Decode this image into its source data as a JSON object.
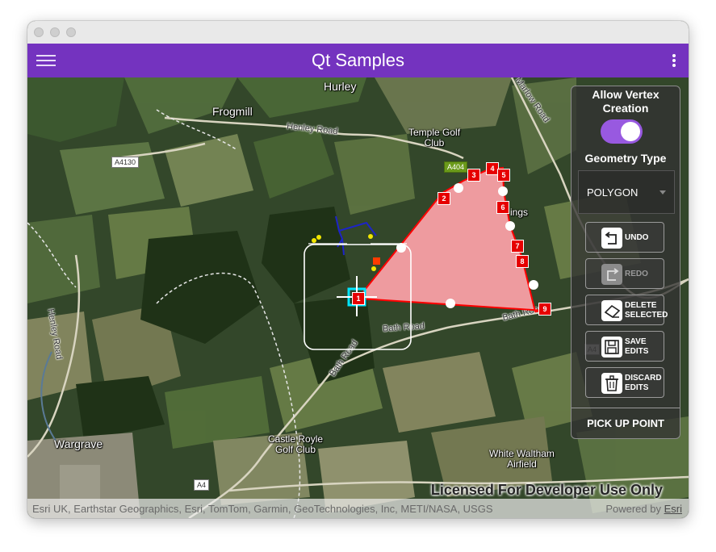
{
  "window": {
    "app_title": "Qt Samples"
  },
  "icons": {
    "menu": "hamburger-menu-icon",
    "more": "more-vertical-icon",
    "undo": "undo-icon",
    "redo": "redo-icon",
    "delete": "eraser-icon",
    "save": "floppy-disk-icon",
    "discard": "trash-icon"
  },
  "colors": {
    "app_bar": "#7433bf",
    "toggle_on": "#9859e0",
    "polygon_fill": "#f9a0a5",
    "polygon_outline": "#ff0000",
    "vertex_marker": "#e60000",
    "selected_vertex_halo": "#00e5ff",
    "sketch_line": "#1d24c8"
  },
  "map_labels": {
    "hurley": "Hurley",
    "frogmill": "Frogmill",
    "henley_road_top": "Henley Road",
    "temple_golf_club": "Temple Golf\nClub",
    "marlow_road": "Marlow Road",
    "a4130": "A4130",
    "a404": "A404",
    "ings": "ings",
    "bath_road_1": "Bath Road",
    "bath_road_2": "Bath Road",
    "bath_road_3": "Bath Road",
    "henley_road_left": "Henley Road",
    "wargrave": "Wargrave",
    "castle_royle": "Castle Royle\nGolf Club",
    "white_waltham": "White Waltham\nAirfield",
    "a4_shield": "A4",
    "a4_right_shield": "A4"
  },
  "vertices": [
    "1",
    "2",
    "3",
    "4",
    "5",
    "6",
    "7",
    "8",
    "9"
  ],
  "panel": {
    "allow_vertex_label": "Allow Vertex Creation",
    "allow_vertex_on": true,
    "geometry_type_label": "Geometry Type",
    "geometry_type_value": "POLYGON",
    "buttons": {
      "undo": "UNDO",
      "redo": "REDO",
      "delete": "DELETE SELECTED",
      "save": "SAVE EDITS",
      "discard": "DISCARD EDITS"
    },
    "pick_up_point": "PICK UP POINT"
  },
  "license_text": "Licensed For Developer Use Only",
  "attribution": "Esri UK, Earthstar Geographics, Esri, TomTom, Garmin, GeoTechnologies, Inc, METI/NASA, USGS",
  "powered_by": "Powered by",
  "powered_by_link": "Esri"
}
